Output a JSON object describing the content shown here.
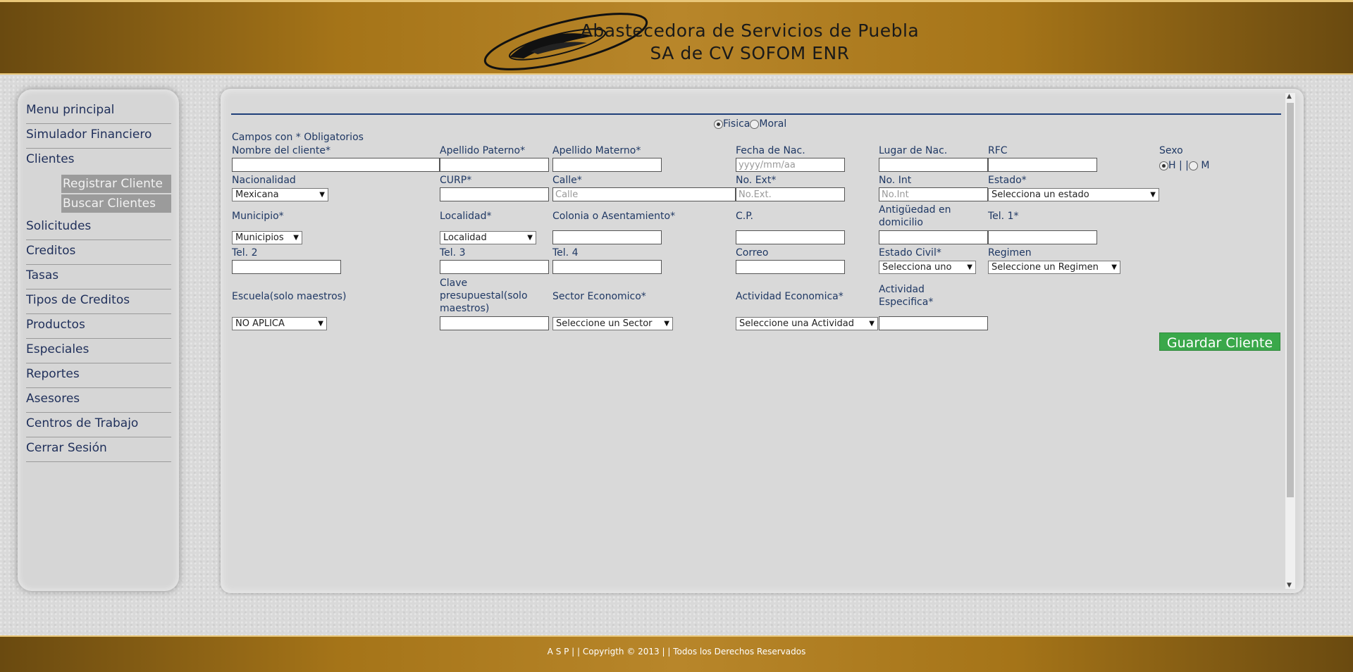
{
  "header": {
    "title_line1": "Abastecedora de Servicios de Puebla",
    "title_line2": "SA de CV SOFOM ENR"
  },
  "sidebar": {
    "items": [
      {
        "label": "Menu principal"
      },
      {
        "label": "Simulador Financiero"
      },
      {
        "label": "Clientes"
      },
      {
        "label": "Solicitudes"
      },
      {
        "label": "Creditos"
      },
      {
        "label": "Tasas"
      },
      {
        "label": "Tipos de Creditos"
      },
      {
        "label": "Productos"
      },
      {
        "label": "Especiales"
      },
      {
        "label": "Reportes"
      },
      {
        "label": "Asesores"
      },
      {
        "label": "Centros de Trabajo"
      },
      {
        "label": "Cerrar Sesión"
      }
    ],
    "clientes_submenu": [
      {
        "label": "Registrar Cliente"
      },
      {
        "label": "Buscar Clientes"
      }
    ]
  },
  "form": {
    "person_type": {
      "fisica": "Fisica",
      "moral": "Moral",
      "selected": "Fisica"
    },
    "required_note": "Campos con * Obligatorios",
    "labels": {
      "nombre": "Nombre del cliente*",
      "apellido_paterno": "Apellido Paterno*",
      "apellido_materno": "Apellido Materno*",
      "fecha_nac": "Fecha de Nac.",
      "lugar_nac": "Lugar de Nac.",
      "rfc": "RFC",
      "sexo": "Sexo",
      "nacionalidad": "Nacionalidad",
      "curp": "CURP*",
      "calle": "Calle*",
      "no_ext": "No. Ext*",
      "no_int": "No. Int",
      "estado": "Estado*",
      "municipio": "Municipio*",
      "localidad": "Localidad*",
      "colonia": "Colonia o Asentamiento*",
      "cp": "C.P.",
      "antiguedad": "Antigüedad en domicilio",
      "tel1": "Tel. 1*",
      "tel2": "Tel. 2",
      "tel3": "Tel. 3",
      "tel4": "Tel. 4",
      "correo": "Correo",
      "estado_civil": "Estado Civil*",
      "regimen": "Regimen",
      "escuela": "Escuela(solo maestros)",
      "clave_presupuestal": "Clave presupuestal(solo maestros)",
      "sector": "Sector Economico*",
      "actividad": "Actividad Economica*",
      "actividad_especifica": "Actividad Especifica*"
    },
    "placeholders": {
      "fecha_nac": "yyyy/mm/aa",
      "calle": "Calle",
      "no_ext": "No.Ext.",
      "no_int": "No.Int"
    },
    "sexo_options": {
      "h": "H",
      "separator": "| |",
      "m": "M",
      "selected": "H"
    },
    "selects": {
      "nacionalidad": "Mexicana",
      "estado": "Selecciona un estado",
      "municipio": "Municipios",
      "localidad": "Localidad",
      "estado_civil": "Selecciona uno",
      "regimen": "Seleccione un Regimen",
      "escuela": "NO APLICA",
      "sector": "Seleccione un Sector",
      "actividad": "Seleccione una Actividad"
    },
    "save_button": "Guardar Cliente"
  },
  "footer": {
    "text": "A S P  | | Copyrigth © 2013  | | Todos los Derechos Reservados"
  },
  "colors": {
    "header_gold": "#a57418",
    "label_blue": "#1f3864",
    "save_green": "#3aa84a",
    "submenu_grey": "#9b9b9b"
  }
}
